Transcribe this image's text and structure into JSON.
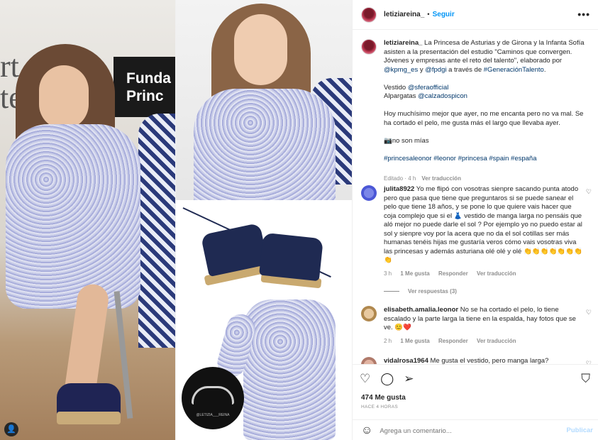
{
  "media": {
    "banner_text": "Funda\nPrinc",
    "wall_letters": "rt\nte",
    "tiara_caption": "@LETIZIA___REINA"
  },
  "header": {
    "username": "letiziareina_",
    "follow_label": "Seguir",
    "dot": "•",
    "more": "•••"
  },
  "caption": {
    "username": "letiziareina_",
    "text_1": " La Princesa de Asturias y de Girona y la Infanta Sofía asisten a la presentación del estudio \"Caminos que convergen. Jóvenes y empresas ante el reto del talento\", elaborado por ",
    "mention_1": "@kpmg_es",
    "text_2": " y ",
    "mention_2": "@fpdgi",
    "text_3": " a través de ",
    "mention_3": "#GeneraciónTalento",
    "text_4": ".\n\nVestido ",
    "mention_4": "@sferaofficial",
    "text_5": "\nAlpargatas ",
    "mention_5": "@calzadospicon",
    "text_6": "\n\nHoy muchísimo mejor que ayer, no me encanta pero no va mal. Se ha cortado el pelo, me gusta más el largo que llevaba ayer.\n\n📷no son mías\n\n",
    "hashtags": "#princesaleonor #leonor #princesa #spain #españa",
    "edited": "Editado · 4 h",
    "see_translation": "Ver traducción"
  },
  "comments": [
    {
      "username": "julita8922",
      "text": " Yo me flipó con vosotras sienpre sacando punta atodo pero que pasa que tiene que preguntaros si se puede sanear el pelo que tiene 18 años, y se pone lo que quiere vais hacer que coja complejo que si el 👗 vestido de manga larga no pensáis que aló mejor no puede darle el sol ? Por ejemplo yo no puedo estar al sol y sienpre voy por la acera que no da el sol cotillas ser más humanas tenéis hijas me gustaría veros cómo vais vosotras viva las princesas y además asturiana olé olé y olé 👏👏👏👏👏👏👏👏",
      "time": "3 h",
      "likes": "1 Me gusta",
      "reply": "Responder",
      "translate": "Ver traducción",
      "replies": "Ver respuestas (3)",
      "avatar_color": "#4b57d6"
    },
    {
      "username": "elisabeth.amalia.leonor",
      "text": " No se ha cortado el pelo, lo tiene escalado y la parte larga la tiene en la espalda, hay fotos que se ve. 😊❤️",
      "time": "2 h",
      "likes": "1 Me gusta",
      "reply": "Responder",
      "translate": "Ver traducción",
      "avatar_color": "#c9a06a"
    },
    {
      "username": "vidalrosa1964",
      "text": " Me gusta el vestido, pero manga larga?",
      "avatar_color": "#b07a6a"
    }
  ],
  "actions": {
    "likes": "474 Me gusta",
    "time_ago": "HACE 4 HORAS",
    "comment_placeholder": "Agrega un comentario...",
    "publish": "Publicar"
  }
}
